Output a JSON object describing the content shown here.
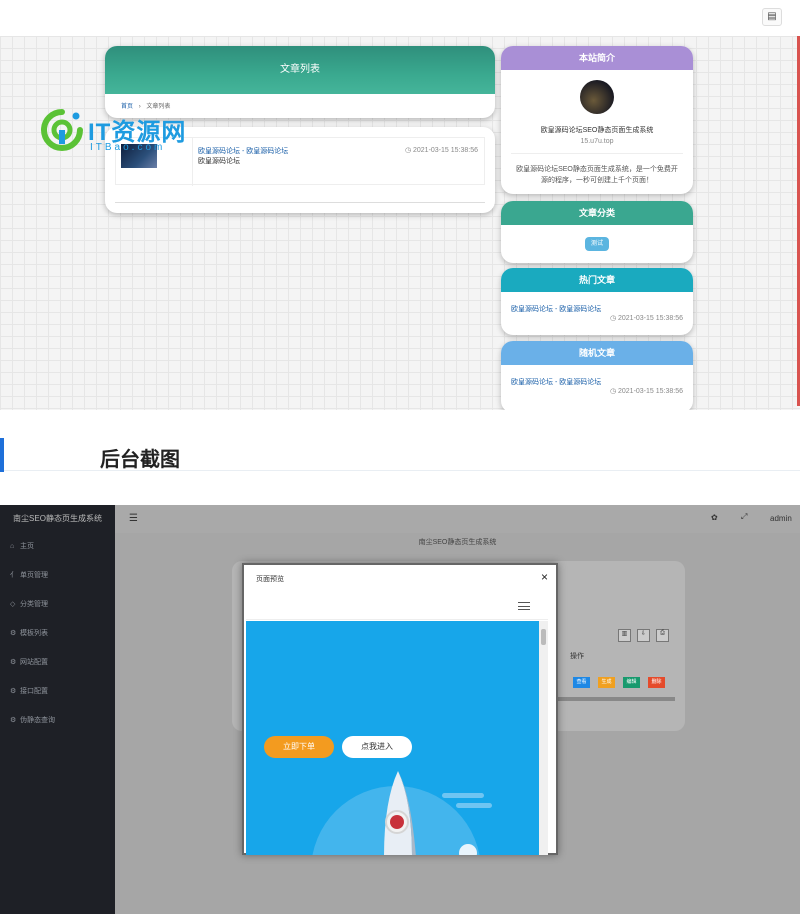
{
  "front": {
    "list_title": "文章列表",
    "breadcrumb": {
      "home": "首页",
      "sep": "›",
      "current": "文章列表"
    },
    "article": {
      "title": "欧皇源码论坛 - 欧皇源码论坛",
      "desc": "欧皇源码论坛",
      "time": "◷ 2021-03-15 15:38:56"
    },
    "intro": {
      "head": "本站简介",
      "name": "欧皇源码论坛SEO静态页面生成系统",
      "url": "15.u7u.top",
      "desc_line1": "欧皇源码论坛SEO静态页面生成系统，是一个免费开",
      "desc_line2": "源的程序，一秒可创建上千个页面！"
    },
    "category": {
      "head": "文章分类",
      "tag": "测试"
    },
    "hot": {
      "head": "热门文章",
      "title": "欧皇源码论坛 - 欧皇源码论坛",
      "time": "◷ 2021-03-15 15:38:56"
    },
    "random": {
      "head": "随机文章",
      "title": "欧皇源码论坛 - 欧皇源码论坛",
      "time": "◷ 2021-03-15 15:38:56"
    },
    "colors": {
      "teal": "#3aa790",
      "purple": "#a98fd6",
      "cyan": "#1aaabf",
      "blue": "#6ab0e8"
    }
  },
  "watermark": {
    "text": "IT资源网",
    "sub": "ITBao.com"
  },
  "section_title": "后台截图",
  "admin": {
    "sidebar_title": "南尘SEO静态页生成系统",
    "menu": [
      "主页",
      "单页管理",
      "分类管理",
      "模板列表",
      "网站配置",
      "接口配置",
      "伪静态查询"
    ],
    "menu_icons": [
      "⌂",
      "⺅",
      "◇",
      "⚙",
      "⚙",
      "⚙",
      "⚙"
    ],
    "header_menu_icon": "☰",
    "header_user": "admin",
    "subtitle": "南尘SEO静态页生成系统",
    "table_header": "操作",
    "ops": [
      "查看",
      "生成",
      "编辑",
      "删除"
    ],
    "modal": {
      "title": "页面预览",
      "close": "×",
      "btn_order": "立即下单",
      "btn_enter": "点我进入"
    }
  }
}
